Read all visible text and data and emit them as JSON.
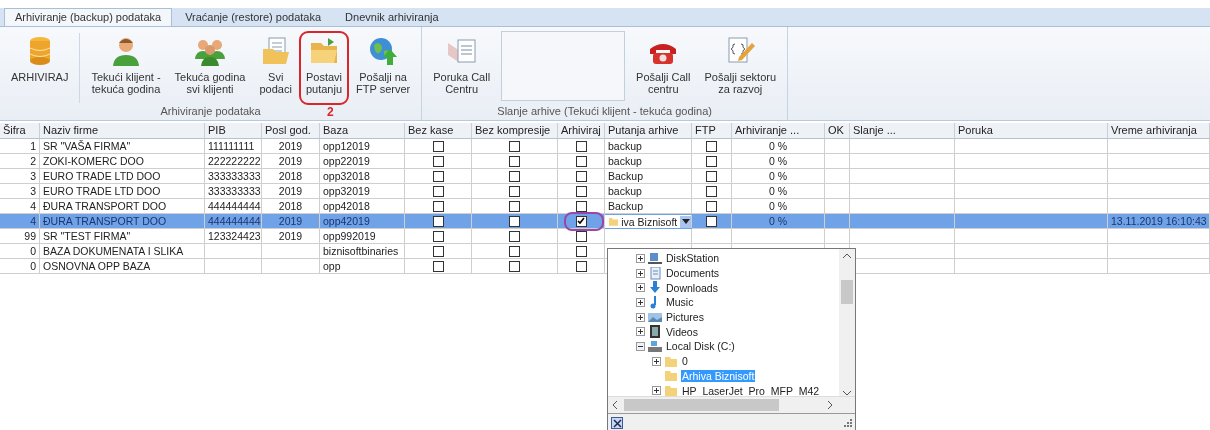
{
  "tabs": [
    {
      "label": "Arhiviranje (backup) podataka",
      "selected": true
    },
    {
      "label": "Vraćanje (restore) podataka",
      "selected": false
    },
    {
      "label": "Dnevnik arhiviranja",
      "selected": false
    }
  ],
  "ribbon": {
    "groups": [
      {
        "label": "Arhiviranje podataka",
        "items": [
          {
            "kind": "button",
            "label": "ARHIVIRAJ",
            "highlight": false
          },
          {
            "kind": "button",
            "label": "Tekući klijent -\ntekuća godina",
            "highlight": false
          },
          {
            "kind": "button",
            "label": "Tekuća godina\nsvi klijenti",
            "highlight": false
          },
          {
            "kind": "button",
            "label": "Svi\npodaci",
            "highlight": false
          },
          {
            "kind": "button",
            "label": "Postavi\nputanju",
            "highlight": true,
            "annotation": "2"
          },
          {
            "kind": "button",
            "label": "Pošalji na\nFTP server",
            "highlight": false
          }
        ]
      },
      {
        "label": "Slanje arhive (Tekući klijent - tekuća godina)",
        "items": [
          {
            "kind": "button",
            "label": "Poruka Call\nCentru",
            "highlight": false
          },
          {
            "kind": "textbox"
          },
          {
            "kind": "button",
            "label": "Pošalji Call\ncentru",
            "highlight": false
          },
          {
            "kind": "button",
            "label": "Pošalji sektoru\nza razvoj",
            "highlight": false
          }
        ]
      }
    ]
  },
  "grid": {
    "columns": [
      "Šifra",
      "Naziv firme",
      "PIB",
      "Posl god.",
      "Baza",
      "Bez kase",
      "Bez kompresije",
      "Arhiviraj",
      "Putanja arhive",
      "FTP",
      "Arhiviranje ...",
      "OK",
      "Slanje ...",
      "Poruka",
      "Vreme arhiviranja"
    ],
    "rows": [
      {
        "sifra": "1",
        "naziv": "SR \"VAŠA FIRMA\"",
        "pib": "111111111",
        "god": "2019",
        "baza": "opp12019",
        "bez_kase": false,
        "bez_kompresije": false,
        "arhiviraj": false,
        "putanja": "backup",
        "ftp": false,
        "progress": "0 %",
        "selected": false,
        "highlight": false
      },
      {
        "sifra": "2",
        "naziv": "ZOKI-KOMERC DOO",
        "pib": "222222222",
        "god": "2019",
        "baza": "opp22019",
        "bez_kase": false,
        "bez_kompresije": false,
        "arhiviraj": false,
        "putanja": "backup",
        "ftp": false,
        "progress": "0 %",
        "selected": false,
        "highlight": false
      },
      {
        "sifra": "3",
        "naziv": "EURO TRADE LTD DOO",
        "pib": "333333333",
        "god": "2018",
        "baza": "opp32018",
        "bez_kase": false,
        "bez_kompresije": false,
        "arhiviraj": false,
        "putanja": "Backup",
        "ftp": false,
        "progress": "0 %",
        "selected": false,
        "highlight": false
      },
      {
        "sifra": "3",
        "naziv": "EURO TRADE LTD DOO",
        "pib": "333333333",
        "god": "2019",
        "baza": "opp32019",
        "bez_kase": false,
        "bez_kompresije": false,
        "arhiviraj": false,
        "putanja": "backup",
        "ftp": false,
        "progress": "0 %",
        "selected": false,
        "highlight": false
      },
      {
        "sifra": "4",
        "naziv": "ĐURA TRANSPORT DOO",
        "pib": "444444444",
        "god": "2018",
        "baza": "opp42018",
        "bez_kase": false,
        "bez_kompresije": false,
        "arhiviraj": false,
        "putanja": "Backup",
        "ftp": false,
        "progress": "0 %",
        "selected": false,
        "highlight": false
      },
      {
        "sifra": "4",
        "naziv": "ĐURA TRANSPORT DOO",
        "pib": "444444444",
        "god": "2019",
        "baza": "opp42019",
        "bez_kase": false,
        "bez_kompresije": false,
        "arhiviraj": true,
        "putanja_editor": "iva Biznisoft",
        "ftp": false,
        "progress": "0 %",
        "vreme": "13.11.2019 16:10:43",
        "selected": true,
        "highlight": true
      },
      {
        "sifra": "99",
        "naziv": "SR \"TEST FIRMA\"",
        "pib": "123324423",
        "god": "2019",
        "baza": "opp992019",
        "bez_kase": false,
        "bez_kompresije": false,
        "arhiviraj": false,
        "selected": false,
        "highlight": false
      },
      {
        "sifra": "0",
        "naziv": "BAZA DOKUMENATA I SLIKA",
        "baza": "biznisoftbinaries",
        "bez_kase": false,
        "bez_kompresije": false,
        "arhiviraj": false,
        "selected": false,
        "highlight": false
      },
      {
        "sifra": "0",
        "naziv": "OSNOVNA OPP BAZA",
        "baza": "opp",
        "bez_kase": false,
        "bez_kompresije": false,
        "arhiviraj": false,
        "selected": false,
        "highlight": false
      }
    ]
  },
  "folder_dropdown": {
    "tree": [
      {
        "label": "DiskStation",
        "expandable": true,
        "expanded": false,
        "selected": false
      },
      {
        "label": "Documents",
        "expandable": true,
        "expanded": false,
        "selected": false
      },
      {
        "label": "Downloads",
        "expandable": true,
        "expanded": false,
        "selected": false
      },
      {
        "label": "Music",
        "expandable": true,
        "expanded": false,
        "selected": false
      },
      {
        "label": "Pictures",
        "expandable": true,
        "expanded": false,
        "selected": false
      },
      {
        "label": "Videos",
        "expandable": true,
        "expanded": false,
        "selected": false
      },
      {
        "label": "Local Disk (C:)",
        "expandable": true,
        "expanded": true,
        "selected": false,
        "children": [
          {
            "label": "0",
            "expandable": true,
            "selected": false
          },
          {
            "label": "Arhiva Biznisoft",
            "expandable": false,
            "selected": true
          },
          {
            "label": "HP_LaserJet_Pro_MFP_M42",
            "expandable": true,
            "selected": false
          }
        ]
      }
    ]
  }
}
